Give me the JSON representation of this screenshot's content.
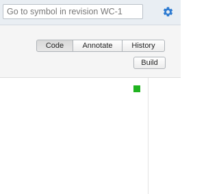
{
  "search": {
    "placeholder": "Go to symbol in revision WC-1"
  },
  "icons": {
    "settings": "gear-icon",
    "comments": "comment-icon"
  },
  "toolbar": {
    "tabs": [
      {
        "label": "Code",
        "active": true
      },
      {
        "label": "Annotate",
        "active": false
      },
      {
        "label": "History",
        "active": false
      }
    ],
    "build_label": "Build"
  },
  "colors": {
    "accent": "#2e7bd1",
    "status_green": "#20b320",
    "topbar_bg": "#e9eef3"
  }
}
